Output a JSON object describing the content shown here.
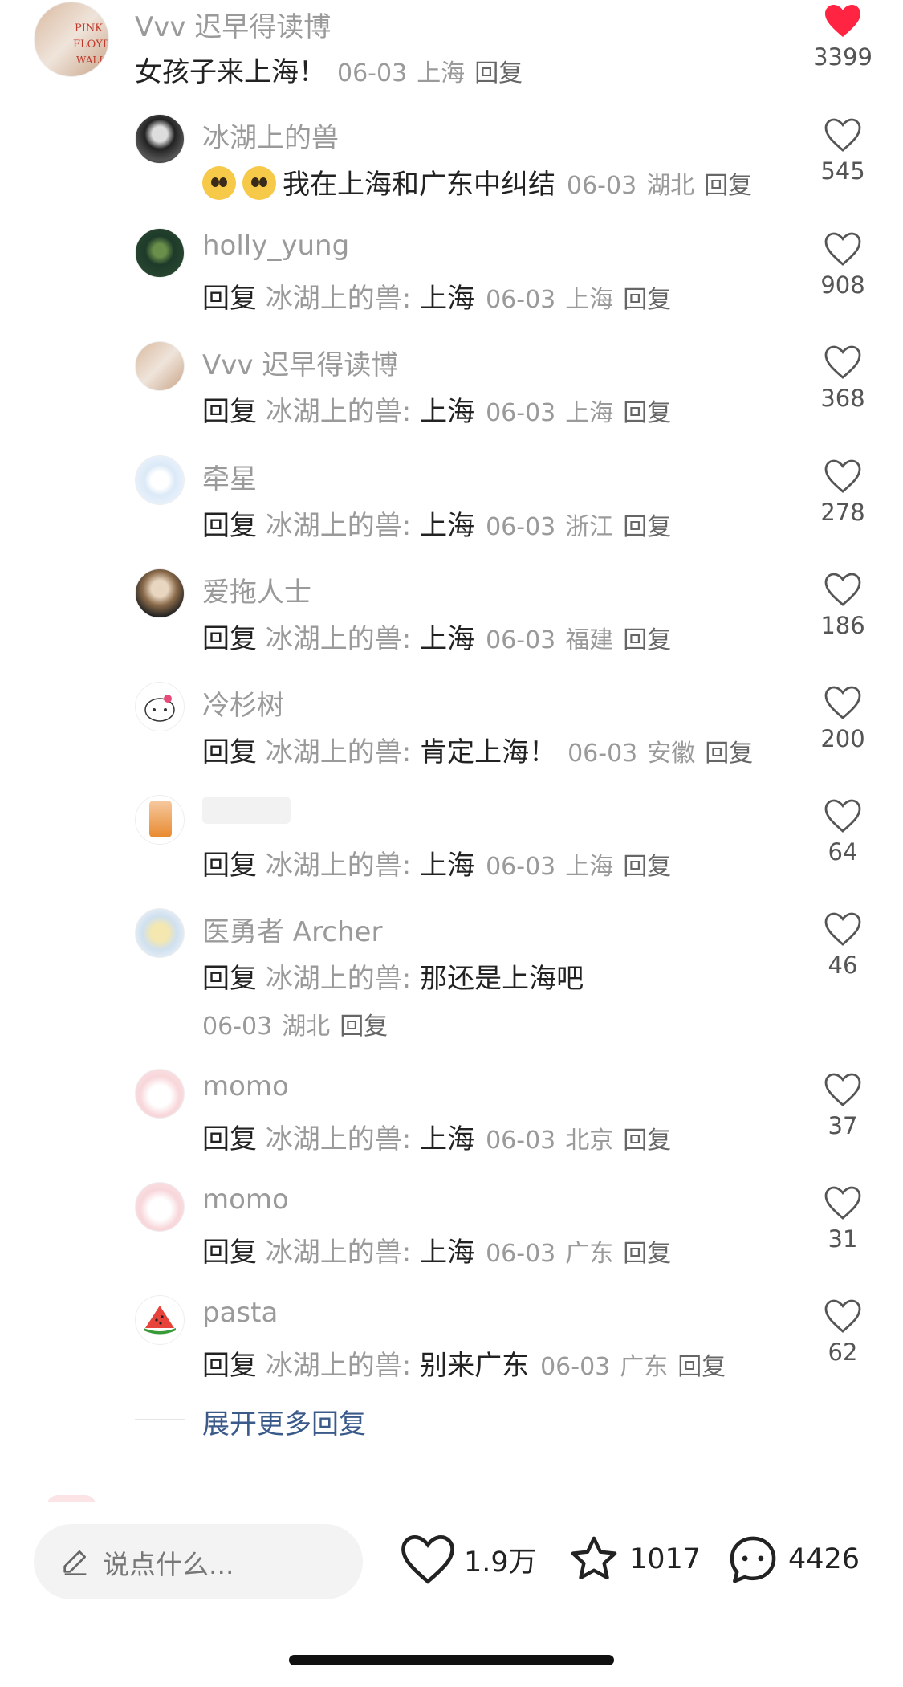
{
  "main_comment": {
    "username": "Vvv 迟早得读博",
    "text": "女孩子来上海！",
    "date": "06-03",
    "location": "上海",
    "reply_label": "回复",
    "likes": "3399",
    "liked": true
  },
  "replies": [
    {
      "username": "冰湖上的兽",
      "text": "我在上海和广东中纠结",
      "date": "06-03",
      "location": "湖北",
      "reply_label": "回复",
      "likes": "545"
    },
    {
      "username": "holly_yung",
      "reply_prefix": "回复",
      "reply_to": "冰湖上的兽:",
      "text": "上海",
      "date": "06-03",
      "location": "上海",
      "reply_label": "回复",
      "likes": "908"
    },
    {
      "username": "Vvv 迟早得读博",
      "reply_prefix": "回复",
      "reply_to": "冰湖上的兽:",
      "text": "上海",
      "date": "06-03",
      "location": "上海",
      "reply_label": "回复",
      "likes": "368"
    },
    {
      "username": "牵星",
      "reply_prefix": "回复",
      "reply_to": "冰湖上的兽:",
      "text": "上海",
      "date": "06-03",
      "location": "浙江",
      "reply_label": "回复",
      "likes": "278"
    },
    {
      "username": "爱拖人士",
      "reply_prefix": "回复",
      "reply_to": "冰湖上的兽:",
      "text": "上海",
      "date": "06-03",
      "location": "福建",
      "reply_label": "回复",
      "likes": "186"
    },
    {
      "username": "冷杉树",
      "reply_prefix": "回复",
      "reply_to": "冰湖上的兽:",
      "text": "肯定上海！",
      "date": "06-03",
      "location": "安徽",
      "reply_label": "回复",
      "likes": "200"
    },
    {
      "username": "",
      "reply_prefix": "回复",
      "reply_to": "冰湖上的兽:",
      "text": "上海",
      "date": "06-03",
      "location": "上海",
      "reply_label": "回复",
      "likes": "64"
    },
    {
      "username": "医勇者 Archer",
      "reply_prefix": "回复",
      "reply_to": "冰湖上的兽:",
      "text": "那还是上海吧",
      "date": "06-03",
      "location": "湖北",
      "reply_label": "回复",
      "likes": "46"
    },
    {
      "username": "momo",
      "reply_prefix": "回复",
      "reply_to": "冰湖上的兽:",
      "text": "上海",
      "date": "06-03",
      "location": "北京",
      "reply_label": "回复",
      "likes": "37"
    },
    {
      "username": "momo",
      "reply_prefix": "回复",
      "reply_to": "冰湖上的兽:",
      "text": "上海",
      "date": "06-03",
      "location": "广东",
      "reply_label": "回复",
      "likes": "31"
    },
    {
      "username": "pasta",
      "reply_prefix": "回复",
      "reply_to": "冰湖上的兽:",
      "text": "别来广东",
      "date": "06-03",
      "location": "广东",
      "reply_label": "回复",
      "likes": "62"
    }
  ],
  "expand_more": "展开更多回复",
  "bottom_bar": {
    "input_placeholder": "说点什么...",
    "likes": "1.9万",
    "favorites": "1017",
    "comments": "4426"
  },
  "colors": {
    "liked_heart": "#ff2442",
    "link": "#3a5a8a"
  }
}
